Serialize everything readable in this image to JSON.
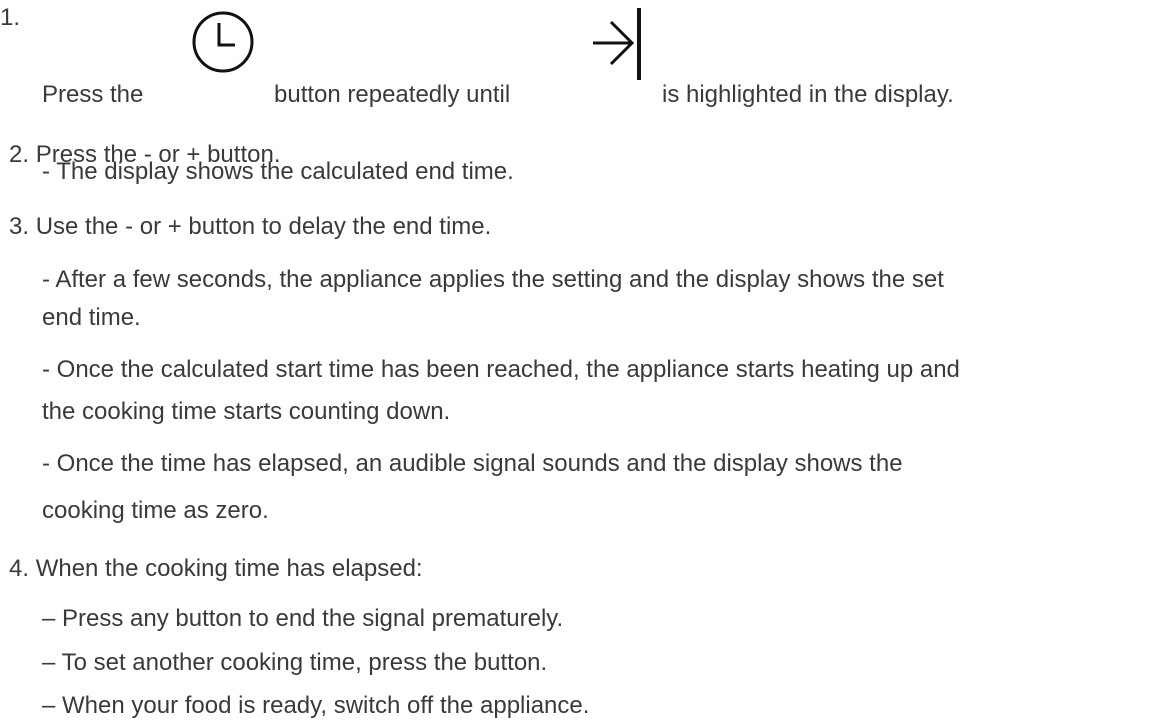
{
  "steps": [
    {
      "number": "1.",
      "text_before_clock": "Press the",
      "text_between": "button repeatedly until",
      "text_after": "is highlighted in the display.",
      "icons": [
        "clock-icon",
        "arrow-to-bar-icon"
      ]
    },
    {
      "number": "2.",
      "text": "Press the - or + button.",
      "notes": [
        "- The display shows the calculated end time."
      ]
    },
    {
      "number": "3.",
      "text": "Use the - or + button to delay the end time.",
      "notes": [
        "- After a few seconds, the appliance applies the setting and the display shows the set",
        "end time.",
        "- Once the calculated start time has been reached, the appliance starts heating up and",
        "the cooking time starts counting down.",
        "- Once the time has elapsed, an audible signal sounds and the display shows the",
        "cooking time as zero."
      ]
    },
    {
      "number": "4.",
      "text": "When the cooking time has elapsed:",
      "bullets": [
        "– Press any button to end the signal prematurely.",
        "– To set another cooking time, press the button.",
        "– When your food is ready, switch off the appliance."
      ]
    }
  ],
  "colors": {
    "text": "#3a3a3a",
    "icon": "#111111"
  }
}
